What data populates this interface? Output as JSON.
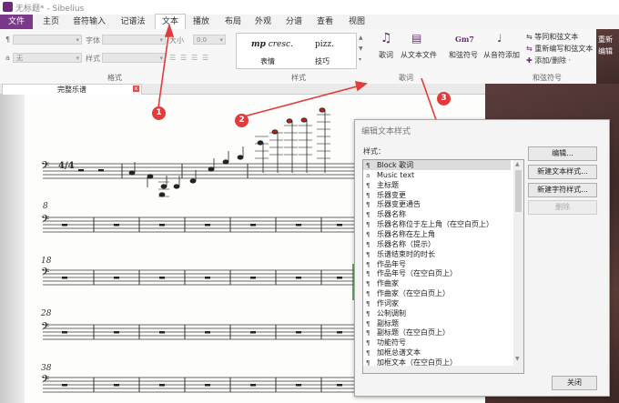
{
  "window": {
    "title": "无标题* - Sibelius"
  },
  "ribbon_tabs": [
    "文件",
    "主页",
    "音符输入",
    "记谱法",
    "文本",
    "播放",
    "布局",
    "外观",
    "分谱",
    "查看",
    "视图"
  ],
  "active_tab": "文本",
  "format_group": {
    "label": "格式",
    "font_label": "字体",
    "size_label": "大小",
    "size_value": "0.0",
    "style_label": "样式",
    "style_value": "无",
    "para_symbol": "¶",
    "a_symbol": "a"
  },
  "styles_group": {
    "label": "样式",
    "items": [
      {
        "sample_bold": "mp",
        "sample_rest": " cresc.",
        "caption": "表情"
      },
      {
        "sample_bold": "",
        "sample_rest": "pizz.",
        "caption": "技巧"
      }
    ]
  },
  "lyrics_group": {
    "label": "歌词",
    "buttons": [
      "歌词",
      "从文本文件"
    ]
  },
  "chord_group": {
    "label": "和弦符号",
    "chord_icon_text": "Gm7",
    "buttons": [
      "和弦符号",
      "从音符添加"
    ],
    "small_buttons": [
      "等同和弦文本",
      "重新编写和弦文本",
      "添加/删除 ·"
    ],
    "cut_off": [
      "重新",
      "编辑"
    ]
  },
  "document_tab": {
    "label": "完整乐谱",
    "close": "x"
  },
  "score": {
    "time_signature": "4/4",
    "bar_numbers": [
      "8",
      "18",
      "28",
      "38"
    ]
  },
  "dialog": {
    "title": "编辑文本样式",
    "list_label": "样式：",
    "styles": [
      {
        "glyph": "¶",
        "name": "Block 歌词"
      },
      {
        "glyph": "a",
        "name": "Music text"
      },
      {
        "glyph": "¶",
        "name": "主标题"
      },
      {
        "glyph": "¶",
        "name": "乐器变更"
      },
      {
        "glyph": "¶",
        "name": "乐器变更通告"
      },
      {
        "glyph": "¶",
        "name": "乐器名称"
      },
      {
        "glyph": "¶",
        "name": "乐器名称位于左上角（在空白页上）"
      },
      {
        "glyph": "¶",
        "name": "乐器名称在左上角"
      },
      {
        "glyph": "¶",
        "name": "乐器名称（提示）"
      },
      {
        "glyph": "¶",
        "name": "乐谱结束时的时长"
      },
      {
        "glyph": "¶",
        "name": "作品年号"
      },
      {
        "glyph": "¶",
        "name": "作品年号（在空白页上）"
      },
      {
        "glyph": "¶",
        "name": "作曲家"
      },
      {
        "glyph": "¶",
        "name": "作曲家（在空白页上）"
      },
      {
        "glyph": "¶",
        "name": "作词家"
      },
      {
        "glyph": "¶",
        "name": "公制调制"
      },
      {
        "glyph": "¶",
        "name": "副标题"
      },
      {
        "glyph": "¶",
        "name": "副标题（在空白页上）"
      },
      {
        "glyph": "¶",
        "name": "功能符号"
      },
      {
        "glyph": "¶",
        "name": "加框总谱文本"
      },
      {
        "glyph": "¶",
        "name": "加框文本（在空白页上）"
      }
    ],
    "buttons": [
      "编辑...",
      "新建文本样式...",
      "新建字符样式...",
      "删除"
    ],
    "close_label": "关闭"
  },
  "annotations": [
    "1",
    "2",
    "3"
  ],
  "colors": {
    "file_tab": "#7b3a89",
    "annotation": "#e23b3b",
    "wood": "#4a302d"
  }
}
